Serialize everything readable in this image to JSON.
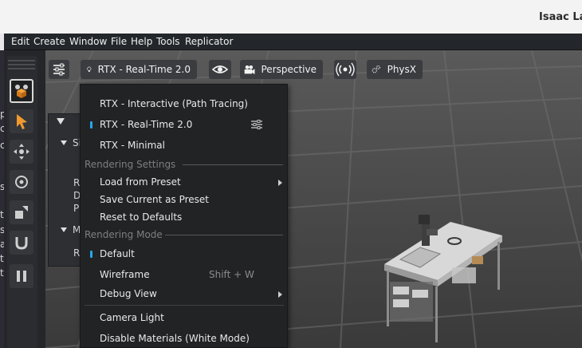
{
  "window": {
    "title": "Isaac La"
  },
  "menubar": {
    "items": [
      "Edit",
      "Create",
      "Window",
      "File",
      "Help",
      "Tools",
      "Replicator"
    ]
  },
  "viewport_toolbar": {
    "renderer_label": "RTX - Real-Time 2.0",
    "camera_label": "Perspective",
    "physics_label": "PhysX"
  },
  "left_underlay_chars": [
    "p",
    "c",
    "c",
    "s",
    "t",
    "s",
    "a",
    "t",
    "t"
  ],
  "panel": {
    "rows": [
      "Si",
      "R",
      "D",
      "P",
      "M",
      "R"
    ]
  },
  "dropdown": {
    "renderers": [
      {
        "label": "RTX - Interactive (Path Tracing)",
        "active": false
      },
      {
        "label": "RTX - Real-Time 2.0",
        "active": true
      },
      {
        "label": "RTX - Minimal",
        "active": false
      }
    ],
    "rendering_settings_header": "Rendering Settings",
    "settings_items": [
      {
        "label": "Load from Preset",
        "submenu": true
      },
      {
        "label": "Save Current as Preset",
        "submenu": false
      },
      {
        "label": "Reset to Defaults",
        "submenu": false
      }
    ],
    "rendering_mode_header": "Rendering Mode",
    "mode_items": [
      {
        "label": "Default",
        "active": true,
        "shortcut": ""
      },
      {
        "label": "Wireframe",
        "active": false,
        "shortcut": "Shift + W"
      },
      {
        "label": "Debug View",
        "active": false,
        "shortcut": "",
        "submenu": true
      }
    ],
    "lighting_items": [
      {
        "label": "Camera Light"
      },
      {
        "label": "Disable Materials (White Mode)"
      }
    ]
  },
  "colors": {
    "accent": "#28a6e8",
    "menu_bg": "#212325",
    "toolbar_bg": "#3a3c40"
  }
}
